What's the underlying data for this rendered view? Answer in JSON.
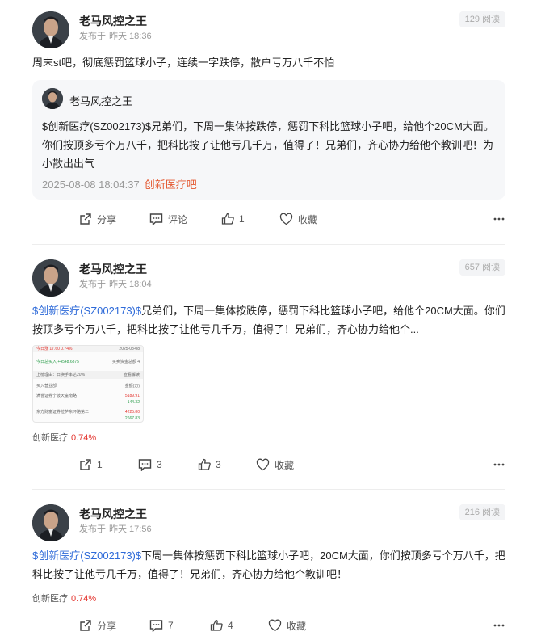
{
  "posts": [
    {
      "author": "老马风控之王",
      "published": "发布于",
      "time": "昨天 18:36",
      "views": "129 阅读",
      "text": "周末st吧，彻底惩罚篮球小子，连续一字跌停，散户亏万八千不怕",
      "quote": {
        "author": "老马风控之王",
        "text": "$创新医疗(SZ002173)$兄弟们，下周一集体按跌停，惩罚下科比篮球小子吧，给他个20CM大面。你们按顶多亏个万八千，把科比按了让他亏几千万，值得了！兄弟们，齐心协力给他个教训吧！为小散出出气",
        "datetime": "2025-08-08 18:04:37",
        "bar": "创新医疗吧"
      },
      "actions": {
        "share": "分享",
        "comment": "评论",
        "like": "1",
        "fav": "收藏"
      }
    },
    {
      "author": "老马风控之王",
      "published": "发布于",
      "time": "昨天 18:04",
      "views": "657 阅读",
      "tag": "$创新医疗(SZ002173)$",
      "text": "兄弟们，下周一集体按跌停，惩罚下科比篮球小子吧，给他个20CM大面。你们按顶多亏个万八千，把科比按了让他亏几千万，值得了！兄弟们，齐心协力给他个...",
      "image": {
        "top_left": "今日涨 17.60  0.74%",
        "top_right": "2025-08-08",
        "row1_left": "今日总买入  +4548.6875",
        "row1_right": "买卖资金总额  4",
        "row2_left": "上榜理由：日换手率达20%",
        "row2_right": "查看解读",
        "row3_left": "买入营业部",
        "row3_right": "金额(万)",
        "row4_left": "满誉证券宁波天童南路",
        "row4_right": "5189.91",
        "row5_right": "144.32",
        "row6_left": "东方财富证券拉萨东环路第二",
        "row6_right": "4225.80",
        "row7_right": "2667.83"
      },
      "stock": "创新医疗",
      "stock_pct": "0.74%",
      "actions": {
        "share": "1",
        "comment": "3",
        "like": "3",
        "fav": "收藏"
      }
    },
    {
      "author": "老马风控之王",
      "published": "发布于",
      "time": "昨天 17:56",
      "views": "216 阅读",
      "tag": "$创新医疗(SZ002173)$",
      "text": "下周一集体按惩罚下科比篮球小子吧，20CM大面，你们按顶多亏个万八千，把科比按了让他亏几千万，值得了！兄弟们，齐心协力给他个教训吧！",
      "stock": "创新医疗",
      "stock_pct": "0.74%",
      "actions": {
        "share": "分享",
        "comment": "7",
        "like": "4",
        "fav": "收藏"
      }
    }
  ],
  "icons": {
    "share": "share-icon",
    "comment": "comment-icon",
    "like": "thumbs-up-icon",
    "fav": "heart-icon",
    "more": "more-icon"
  },
  "colors": {
    "tag": "#2f6bd9",
    "bar_link": "#e4572e",
    "pct_up": "#e4352f"
  }
}
